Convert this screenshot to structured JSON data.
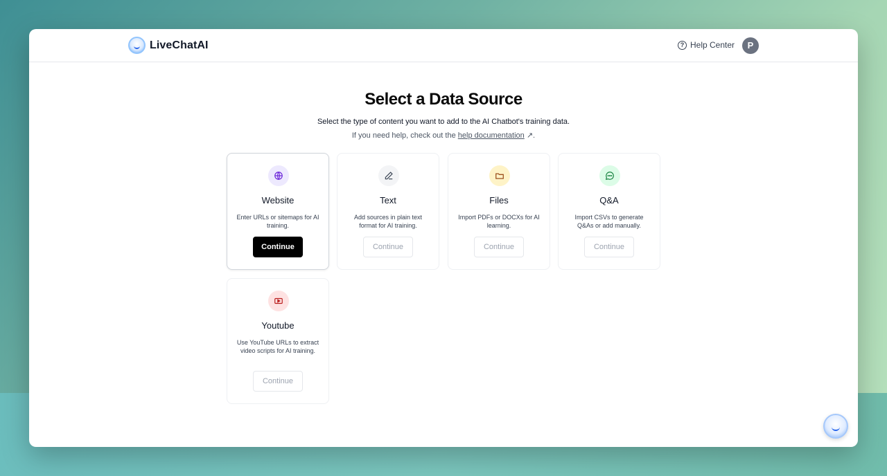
{
  "brand": {
    "name": "LiveChatAI"
  },
  "header": {
    "help_label": "Help Center",
    "avatar_initial": "P"
  },
  "main": {
    "title": "Select a Data Source",
    "subtitle": "Select the type of content you want to add to the AI Chatbot's training data.",
    "help_prefix": "If you need help, check out the ",
    "help_link": "help documentation",
    "help_suffix": " ↗."
  },
  "sources": [
    {
      "title": "Website",
      "description": "Enter URLs or sitemaps for AI training.",
      "button": "Continue",
      "icon": "globe-icon",
      "icon_bg": "#ede9fe",
      "icon_color": "#6d28d9"
    },
    {
      "title": "Text",
      "description": "Add sources in plain text format for AI training.",
      "button": "Continue",
      "icon": "edit-icon",
      "icon_bg": "#f3f4f6",
      "icon_color": "#374151"
    },
    {
      "title": "Files",
      "description": "Import PDFs or DOCXs for AI learning.",
      "button": "Continue",
      "icon": "folder-icon",
      "icon_bg": "#fef3c7",
      "icon_color": "#92400e"
    },
    {
      "title": "Q&A",
      "description": "Import CSVs to generate Q&As or add manually.",
      "button": "Continue",
      "icon": "chat-icon",
      "icon_bg": "#dcfce7",
      "icon_color": "#15803d"
    },
    {
      "title": "Youtube",
      "description": "Use YouTube URLs to extract video scripts for AI training.",
      "button": "Continue",
      "icon": "youtube-icon",
      "icon_bg": "#fee2e2",
      "icon_color": "#b91c1c"
    }
  ],
  "selected_source": "Website"
}
